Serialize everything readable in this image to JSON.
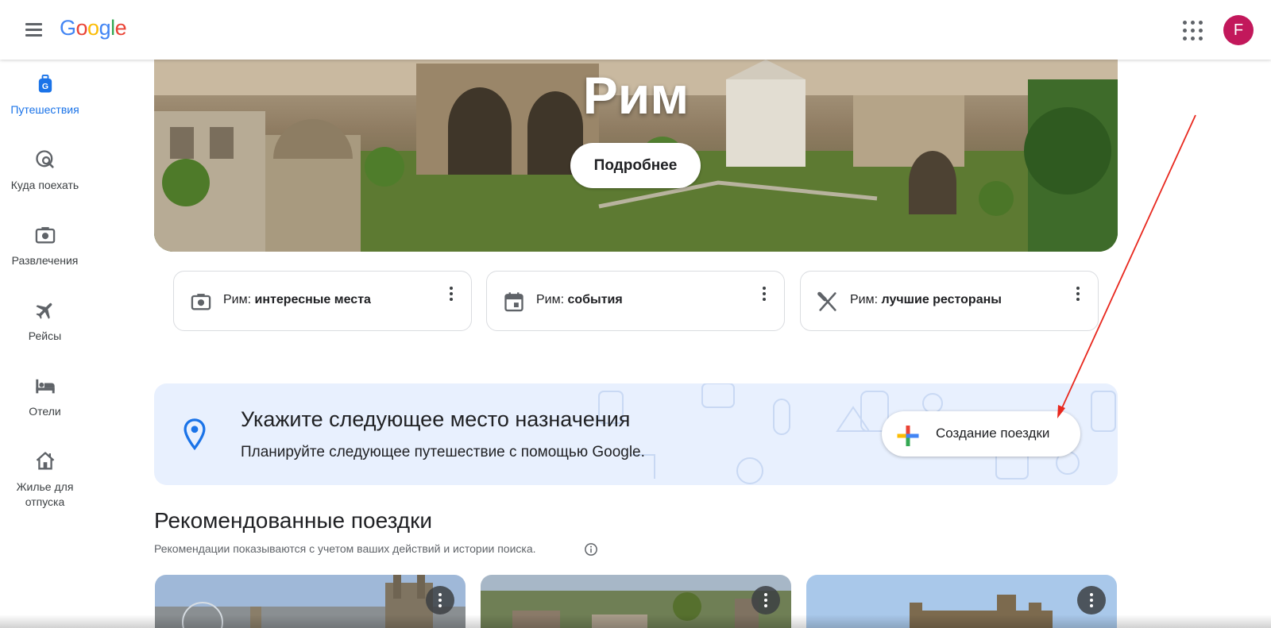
{
  "header": {
    "logo": [
      "G",
      "o",
      "o",
      "g",
      "l",
      "e"
    ],
    "logo_colors": [
      "#4285F4",
      "#EA4335",
      "#FBBC05",
      "#4285F4",
      "#34A853",
      "#EA4335"
    ],
    "avatar_letter": "F",
    "avatar_color": "#c2185b"
  },
  "sidebar": {
    "items": [
      {
        "label": "Путешествия",
        "icon": "travel-bag-icon",
        "active": true
      },
      {
        "label": "Куда поехать",
        "icon": "explore-icon",
        "active": false
      },
      {
        "label": "Развлечения",
        "icon": "camera-icon",
        "active": false
      },
      {
        "label": "Рейсы",
        "icon": "flight-icon",
        "active": false
      },
      {
        "label": "Отели",
        "icon": "hotel-icon",
        "active": false
      },
      {
        "label": "Жилье для отпуска",
        "icon": "home-icon",
        "active": false
      }
    ]
  },
  "hero": {
    "title": "Рим",
    "button": "Подробнее"
  },
  "quick_cards": [
    {
      "prefix": "Рим: ",
      "bold": "интересные места",
      "icon": "camera-icon"
    },
    {
      "prefix": "Рим: ",
      "bold": "события",
      "icon": "calendar-icon"
    },
    {
      "prefix": "Рим: ",
      "bold": "лучшие рестораны",
      "icon": "restaurant-icon"
    }
  ],
  "promo": {
    "title": "Укажите следующее место назначения",
    "subtitle": "Планируйте следующее путешествие с помощью Google.",
    "button": "Создание поездки"
  },
  "recommended": {
    "title": "Рекомендованные поездки",
    "subtitle": "Рекомендации показываются с учетом ваших действий и истории поиска."
  },
  "colors": {
    "accent": "#1a73e8",
    "promo_bg": "#e8f0fe",
    "annotation_arrow": "#e8281e"
  }
}
